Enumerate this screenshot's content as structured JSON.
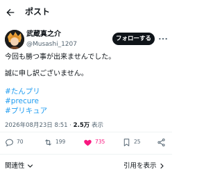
{
  "header": {
    "title": "ポスト"
  },
  "author": {
    "name": "武蔵真之介",
    "handle": "@Musashi_1207",
    "follow_label": "フォローする"
  },
  "post": {
    "line1": "今回も勝つ事が出来ませんでした。",
    "line2": "誠に申し訳ございません。",
    "hashtags": [
      "#たんプリ",
      "#precure",
      "#プリキュア"
    ]
  },
  "meta": {
    "timestamp": "2026年08月23日 8:51",
    "separator": "·",
    "views_count": "2.5万",
    "views_label": "表示"
  },
  "actions": {
    "reply_count": "70",
    "repost_count": "199",
    "like_count": "735",
    "bookmark_count": "25"
  },
  "footer": {
    "related_label": "関連性",
    "quotes_label": "引用を表示"
  },
  "colors": {
    "accent": "#1d9bf0",
    "like": "#f91880",
    "text": "#0f1419",
    "muted": "#536471"
  }
}
